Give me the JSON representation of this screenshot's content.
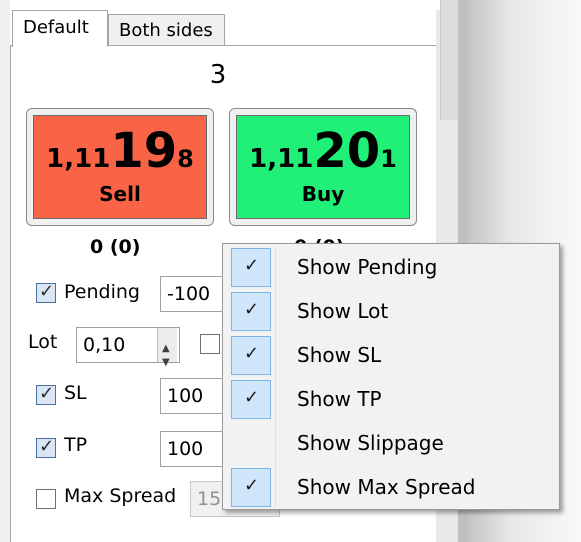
{
  "tabs": [
    {
      "label": "Default",
      "active": true
    },
    {
      "label": "Both sides",
      "active": false
    }
  ],
  "position_count": "3",
  "sell": {
    "prefix": "1,11",
    "big": "19",
    "suffix": "8",
    "label": "Sell",
    "color": "#fa6446",
    "stats": "0 (0)"
  },
  "buy": {
    "prefix": "1,11",
    "big": "20",
    "suffix": "1",
    "label": "Buy",
    "color": "#20f078",
    "stats": "0 (0)"
  },
  "form": {
    "pending": {
      "label": "Pending",
      "checked": true,
      "value": "-100"
    },
    "lot": {
      "label": "Lot",
      "value": "0,10",
      "extra_checked": false
    },
    "sl": {
      "label": "SL",
      "checked": true,
      "value": "100"
    },
    "tp": {
      "label": "TP",
      "checked": true,
      "value": "100"
    },
    "max_spread": {
      "label": "Max Spread",
      "checked": false,
      "value": "15"
    }
  },
  "context_menu": {
    "items": [
      {
        "label": "Show Pending",
        "checked": true
      },
      {
        "label": "Show Lot",
        "checked": true
      },
      {
        "label": "Show SL",
        "checked": true
      },
      {
        "label": "Show TP",
        "checked": true
      },
      {
        "label": "Show Slippage",
        "checked": false
      },
      {
        "label": "Show Max Spread",
        "checked": true
      }
    ]
  }
}
